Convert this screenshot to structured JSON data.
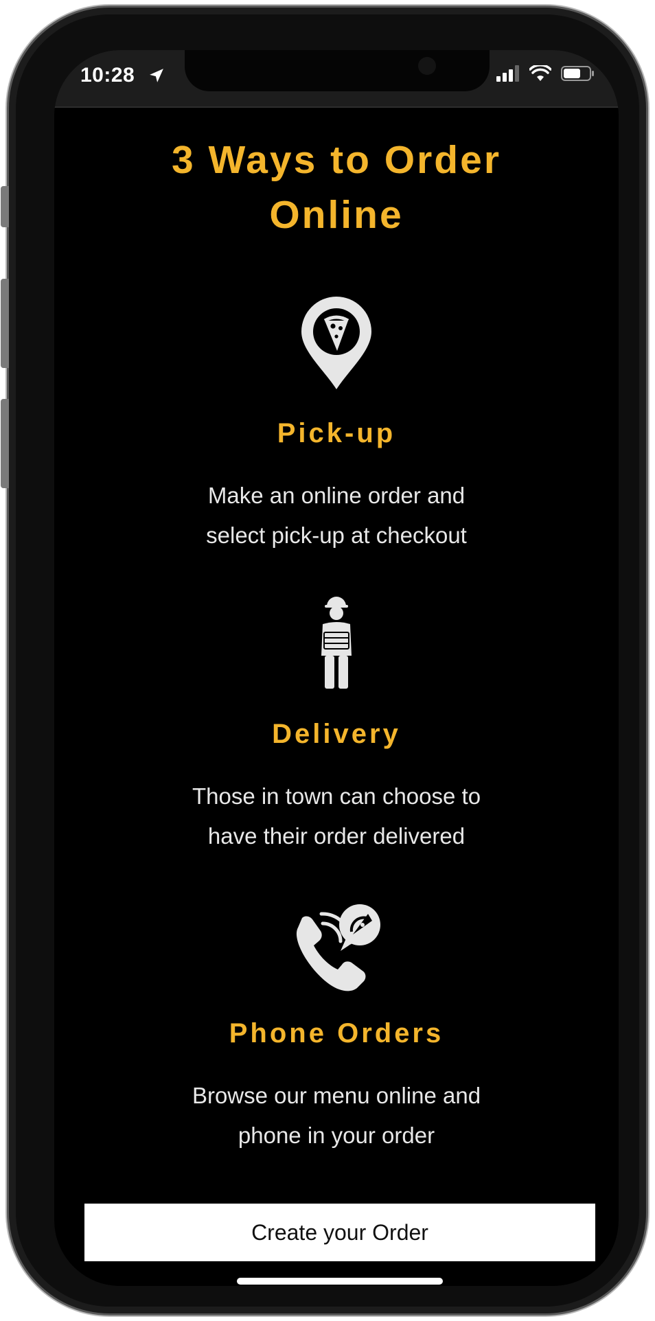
{
  "status_bar": {
    "time": "10:28",
    "icons": [
      "location-arrow-icon",
      "cellular-signal-icon",
      "wifi-icon",
      "battery-icon"
    ]
  },
  "page": {
    "title_lines": [
      "3 Ways to Order",
      "Online"
    ]
  },
  "sections": [
    {
      "icon": "map-pin-pizza-icon",
      "heading": "Pick-up",
      "description_lines": [
        "Make an online order and",
        "select pick-up at checkout"
      ]
    },
    {
      "icon": "delivery-person-icon",
      "heading": "Delivery",
      "description_lines": [
        "Those in town can choose to",
        "have their order delivered"
      ]
    },
    {
      "icon": "phone-pizza-icon",
      "heading": "Phone Orders",
      "description_lines": [
        "Browse our menu online and",
        "phone in your order"
      ]
    }
  ],
  "cta": {
    "label": "Create your Order"
  },
  "colors": {
    "accent": "#f4b52c",
    "background": "#000000",
    "text": "#e8e8e8",
    "button_bg": "#ffffff",
    "button_text": "#111111"
  }
}
